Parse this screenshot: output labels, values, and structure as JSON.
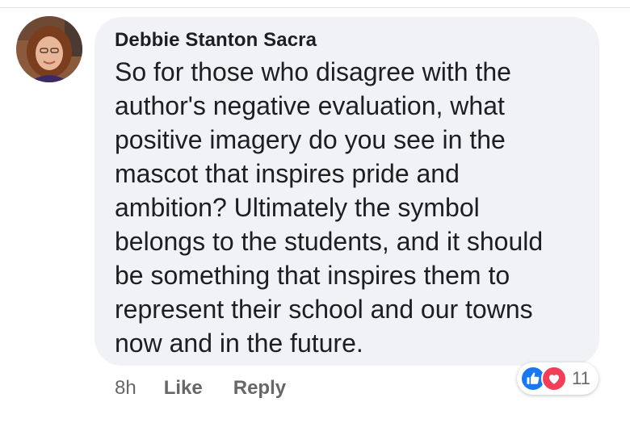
{
  "comment": {
    "author": "Debbie Stanton Sacra",
    "lines": [
      "So for those who disagree with the",
      "author's negative evaluation, what",
      "positive imagery do you see in the",
      "mascot that inspires pride and",
      "ambition? Ultimately the symbol",
      "belongs to the students, and it should",
      "be something that inspires them to",
      "represent their school and our towns",
      "now and in the future."
    ],
    "timestamp": "8h",
    "like_label": "Like",
    "reply_label": "Reply"
  },
  "reactions": {
    "icons": [
      "like-icon",
      "love-icon"
    ],
    "count": "11"
  },
  "colors": {
    "bubble_bg": "#f0f2f5",
    "text": "#1c1e21",
    "meta": "#65676b",
    "like_blue": "#1877f2",
    "love_red": "#f33e58"
  }
}
